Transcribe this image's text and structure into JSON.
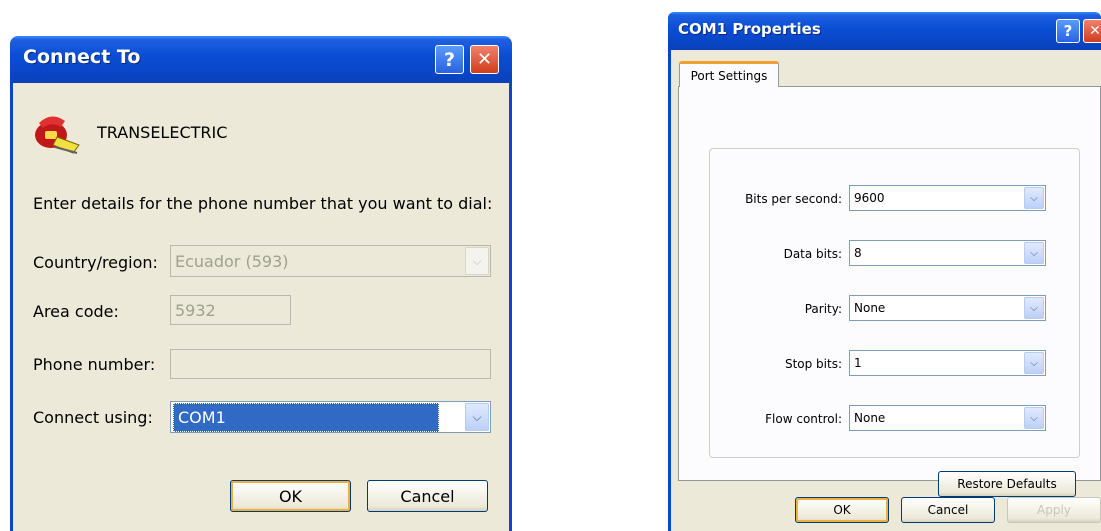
{
  "connect_dialog": {
    "title": "Connect To",
    "help_button": "?",
    "close_button": "✕",
    "connection_name": "TRANSELECTRIC",
    "instructions": "Enter details for the phone number that you want to dial:",
    "country_label": "Country/region:",
    "country_value": "Ecuador (593)",
    "area_code_label": "Area code:",
    "area_code_value": "5932",
    "phone_label": "Phone number:",
    "phone_value": "",
    "connect_using_label": "Connect using:",
    "connect_using_value": "COM1",
    "ok_label": "OK",
    "cancel_label": "Cancel"
  },
  "com_dialog": {
    "title": "COM1 Properties",
    "help_button": "?",
    "close_button": "✕",
    "tab_label": "Port Settings",
    "bits_per_second_label": "Bits per second:",
    "bits_per_second_value": "9600",
    "data_bits_label": "Data bits:",
    "data_bits_value": "8",
    "parity_label": "Parity:",
    "parity_value": "None",
    "stop_bits_label": "Stop bits:",
    "stop_bits_value": "1",
    "flow_control_label": "Flow control:",
    "flow_control_value": "None",
    "restore_defaults_label": "Restore Defaults",
    "ok_label": "OK",
    "cancel_label": "Cancel",
    "apply_label": "Apply"
  },
  "icons": {
    "connection_icon": "phone-icon",
    "dropdown_icon": "chevron-down-icon"
  },
  "colors": {
    "titlebar": "#0a46c8",
    "dialog_face": "#ece9d8",
    "selection": "#316ac5",
    "close_button": "#d23c1e"
  }
}
